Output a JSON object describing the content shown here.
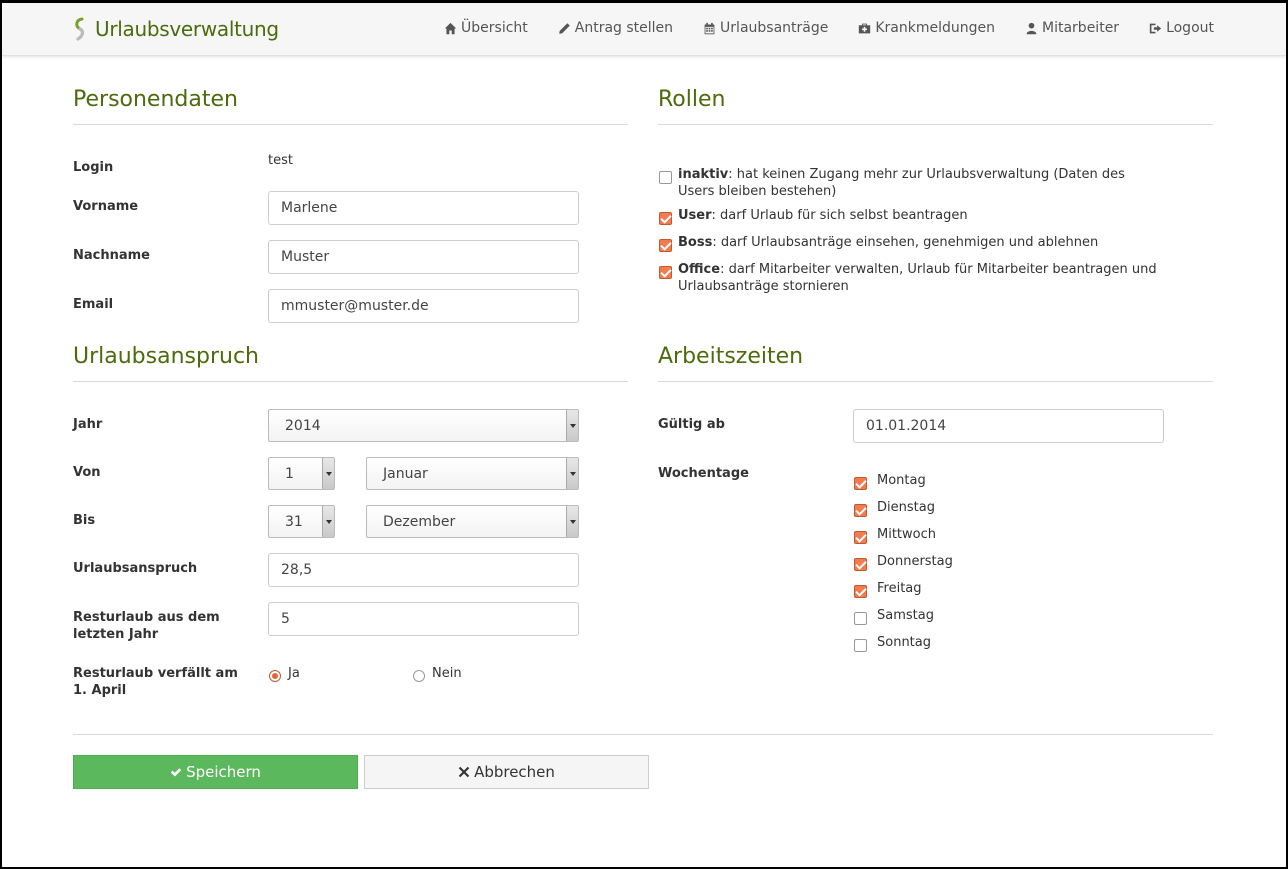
{
  "nav": {
    "brand": "Urlaubsverwaltung",
    "items": [
      {
        "label": "Übersicht",
        "icon": "home-icon"
      },
      {
        "label": "Antrag stellen",
        "icon": "pencil-icon"
      },
      {
        "label": "Urlaubsanträge",
        "icon": "calendar-icon"
      },
      {
        "label": "Krankmeldungen",
        "icon": "medkit-icon"
      },
      {
        "label": "Mitarbeiter",
        "icon": "user-icon"
      },
      {
        "label": "Logout",
        "icon": "sign-out-icon"
      }
    ]
  },
  "personendaten": {
    "title": "Personendaten",
    "login_label": "Login",
    "login_value": "test",
    "vorname_label": "Vorname",
    "vorname_value": "Marlene",
    "nachname_label": "Nachname",
    "nachname_value": "Muster",
    "email_label": "Email",
    "email_value": "mmuster@muster.de"
  },
  "rollen": {
    "title": "Rollen",
    "items": [
      {
        "name": "inaktiv",
        "desc": ": hat keinen Zugang mehr zur Urlaubsverwaltung (Daten des Users bleiben bestehen)",
        "checked": false
      },
      {
        "name": "User",
        "desc": ": darf Urlaub für sich selbst beantragen",
        "checked": true
      },
      {
        "name": "Boss",
        "desc": ": darf Urlaubsanträge einsehen, genehmigen und ablehnen",
        "checked": true
      },
      {
        "name": "Office",
        "desc": ": darf Mitarbeiter verwalten, Urlaub für Mitarbeiter beantragen und Urlaubsanträge stornieren",
        "checked": true
      }
    ]
  },
  "urlaubsanspruch": {
    "title": "Urlaubsanspruch",
    "jahr_label": "Jahr",
    "jahr_value": "2014",
    "von_label": "Von",
    "von_day": "1",
    "von_month": "Januar",
    "bis_label": "Bis",
    "bis_day": "31",
    "bis_month": "Dezember",
    "anspruch_label": "Urlaubsanspruch",
    "anspruch_value": "28,5",
    "rest_label": "Resturlaub aus dem letzten Jahr",
    "rest_value": "5",
    "verfall_label": "Resturlaub verfällt am 1. April",
    "ja_label": "Ja",
    "nein_label": "Nein",
    "verfall_selected": "Ja"
  },
  "arbeitszeiten": {
    "title": "Arbeitszeiten",
    "gueltig_label": "Gültig ab",
    "gueltig_value": "01.01.2014",
    "wochentage_label": "Wochentage",
    "days": [
      {
        "label": "Montag",
        "checked": true
      },
      {
        "label": "Dienstag",
        "checked": true
      },
      {
        "label": "Mittwoch",
        "checked": true
      },
      {
        "label": "Donnerstag",
        "checked": true
      },
      {
        "label": "Freitag",
        "checked": true
      },
      {
        "label": "Samstag",
        "checked": false
      },
      {
        "label": "Sonntag",
        "checked": false
      }
    ]
  },
  "actions": {
    "save_label": "Speichern",
    "cancel_label": "Abbrechen"
  },
  "colors": {
    "brand_green": "#4c6b0c",
    "accent_orange": "#f27c4f",
    "save_green": "#5cb85c"
  }
}
